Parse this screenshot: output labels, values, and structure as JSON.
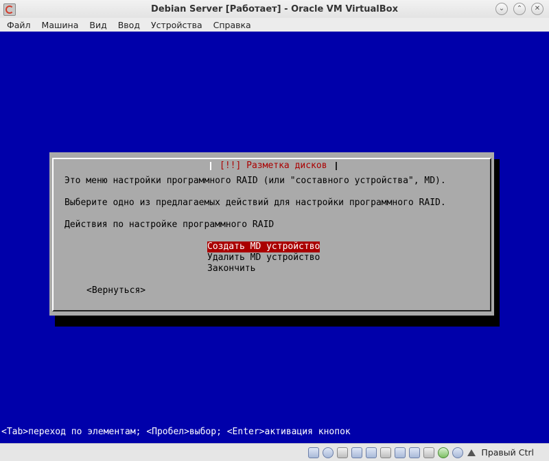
{
  "window": {
    "title": "Debian Server [Работает] - Oracle VM VirtualBox",
    "controls": {
      "minimize": "⌄",
      "maximize": "⌃",
      "close": "✕"
    }
  },
  "menu": [
    "Файл",
    "Машина",
    "Вид",
    "Ввод",
    "Устройства",
    "Справка"
  ],
  "dialog": {
    "title": "[!!] Разметка дисков",
    "line1": "Это меню настройки программного RAID (или \"составного устройства\", MD).",
    "line2": "Выберите одно из предлагаемых действий для настройки программного RAID.",
    "line3": "Действия по настройке программного RAID",
    "options": [
      "Создать MD устройство",
      "Удалить MD устройство",
      "Закончить"
    ],
    "selected_index": 0,
    "back_label": "<Вернуться>"
  },
  "help_line": "<Tab>переход по элементам; <Пробел>выбор; <Enter>активация кнопок",
  "statusbar": {
    "icons": [
      "hard-disk-icon",
      "optical-drive-icon",
      "audio-icon",
      "network-icon",
      "usb-icon",
      "shared-folders-icon",
      "display-icon",
      "video-capture-icon",
      "mouse-integration-icon",
      "cpu-icon",
      "arrow-icon"
    ],
    "host_key": "Правый Ctrl"
  },
  "colors": {
    "vm_background": "#0000aa",
    "dialog_background": "#aaaaaa",
    "selection": "#aa0000",
    "title_text": "#aa0000"
  }
}
